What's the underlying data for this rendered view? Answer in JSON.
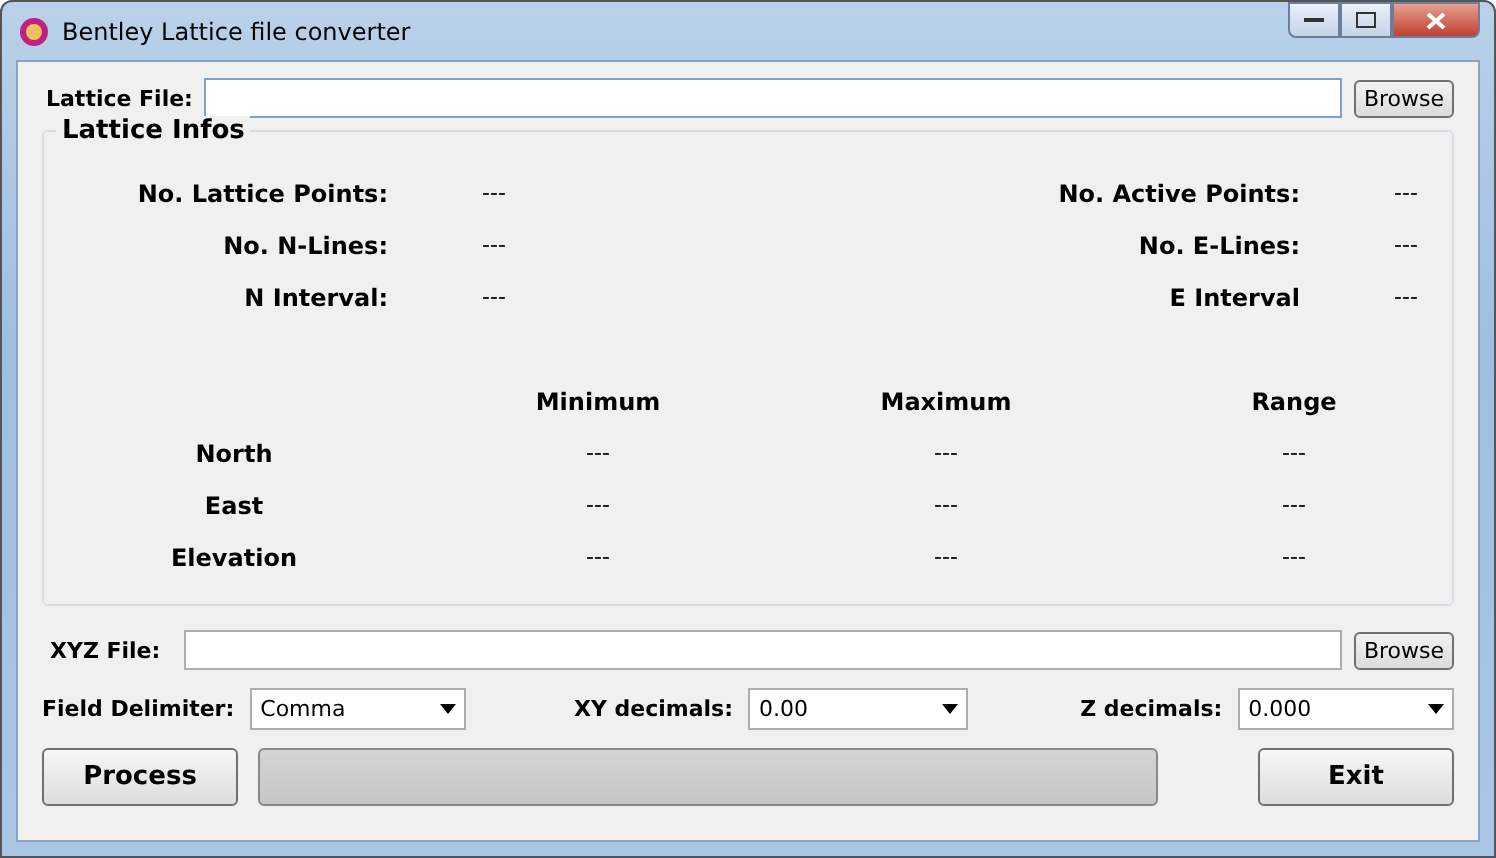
{
  "window": {
    "title": "Bentley Lattice file converter"
  },
  "lattice_file": {
    "label": "Lattice File:",
    "browse": "Browse"
  },
  "lattice_infos": {
    "title": "Lattice Infos",
    "info_rows": [
      {
        "label": "No. Lattice Points:",
        "value": "---",
        "label_2": "No. Active Points:",
        "value_2": "---"
      },
      {
        "label": "No. N-Lines:",
        "value": "---",
        "label_2": "No. E-Lines:",
        "value_2": "---"
      },
      {
        "label": "N Interval:",
        "value": "---",
        "label_2": "E Interval",
        "value_2": "---"
      }
    ],
    "stats": {
      "columns": [
        "Minimum",
        "Maximum",
        "Range"
      ],
      "rows": [
        {
          "label": "North",
          "values": [
            "---",
            "---",
            "---"
          ]
        },
        {
          "label": "East",
          "values": [
            "---",
            "---",
            "---"
          ]
        },
        {
          "label": "Elevation",
          "values": [
            "---",
            "---",
            "---"
          ]
        }
      ]
    }
  },
  "xyz_file": {
    "label": "XYZ File:",
    "browse": "Browse"
  },
  "options": [
    {
      "label": "Field Delimiter:",
      "value": "Comma"
    },
    {
      "label": "XY decimals:",
      "value": "0.00"
    },
    {
      "label": "Z decimals:",
      "value": "0.000"
    }
  ],
  "process_button": "Process",
  "progress": {
    "level": 0
  },
  "exit_button": "Exit"
}
